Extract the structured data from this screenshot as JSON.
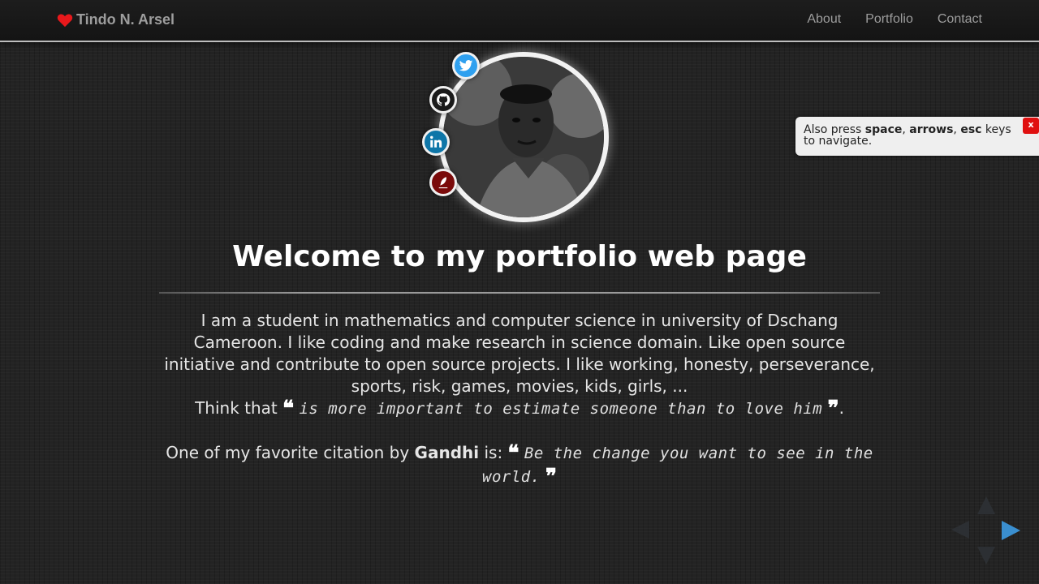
{
  "navbar": {
    "brand": "Tindo N. Arsel",
    "links": [
      "About",
      "Portfolio",
      "Contact"
    ]
  },
  "social_icons": [
    "twitter-icon",
    "github-icon",
    "linkedin-icon",
    "blog-icon"
  ],
  "main": {
    "title": "Welcome to my portfolio web page",
    "bio": "I am a student in mathematics and computer science in university of Dschang Cameroon. I like coding and make research in science domain. Like open source initiative and contribute to open source projects. I like working, honesty, perseverance, sports, risk, games, movies, kids, girls, ...",
    "think_prefix": "Think that",
    "think_quote": "is more important to estimate someone than to love him",
    "think_suffix": ".",
    "citation_prefix": "One of my favorite citation by",
    "citation_author": "Gandhi",
    "citation_mid": "is:",
    "citation_quote": "Be the change you want to see in the world.",
    "open_quote": "❝",
    "close_quote": "❞"
  },
  "toast": {
    "also_press": "Also press",
    "key1": "space",
    "sep1": ",",
    "key2": "arrows",
    "sep2": ",",
    "key3": "esc",
    "keys_word": "keys",
    "to_navigate": "to navigate.",
    "close_label": "x"
  },
  "colors": {
    "accent_heart": "#e8181b",
    "twitter": "#2fa0ef",
    "github": "#1a1a1a",
    "linkedin": "#0e76a8",
    "blog": "#7a0a0a",
    "nav_arrow_active": "#3a8fd0"
  }
}
